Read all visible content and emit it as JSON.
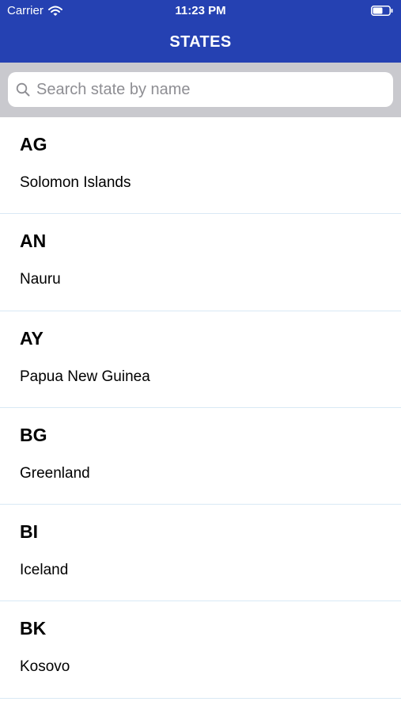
{
  "status_bar": {
    "carrier": "Carrier",
    "time": "11:23 PM",
    "wifi_icon": "wifi-icon",
    "battery_icon": "battery-icon"
  },
  "nav": {
    "title": "STATES"
  },
  "search": {
    "placeholder": "Search state by name",
    "value": "",
    "icon": "search-icon"
  },
  "states": [
    {
      "code": "AG",
      "name": "Solomon Islands"
    },
    {
      "code": "AN",
      "name": "Nauru"
    },
    {
      "code": "AY",
      "name": "Papua New Guinea"
    },
    {
      "code": "BG",
      "name": "Greenland"
    },
    {
      "code": "BI",
      "name": "Iceland"
    },
    {
      "code": "BK",
      "name": "Kosovo"
    }
  ],
  "colors": {
    "header_background": "#2541b2",
    "header_text": "#ffffff",
    "search_bar_background": "#c9c9ce",
    "placeholder_text": "#8e8e93",
    "row_separator": "#d9e9f5"
  }
}
